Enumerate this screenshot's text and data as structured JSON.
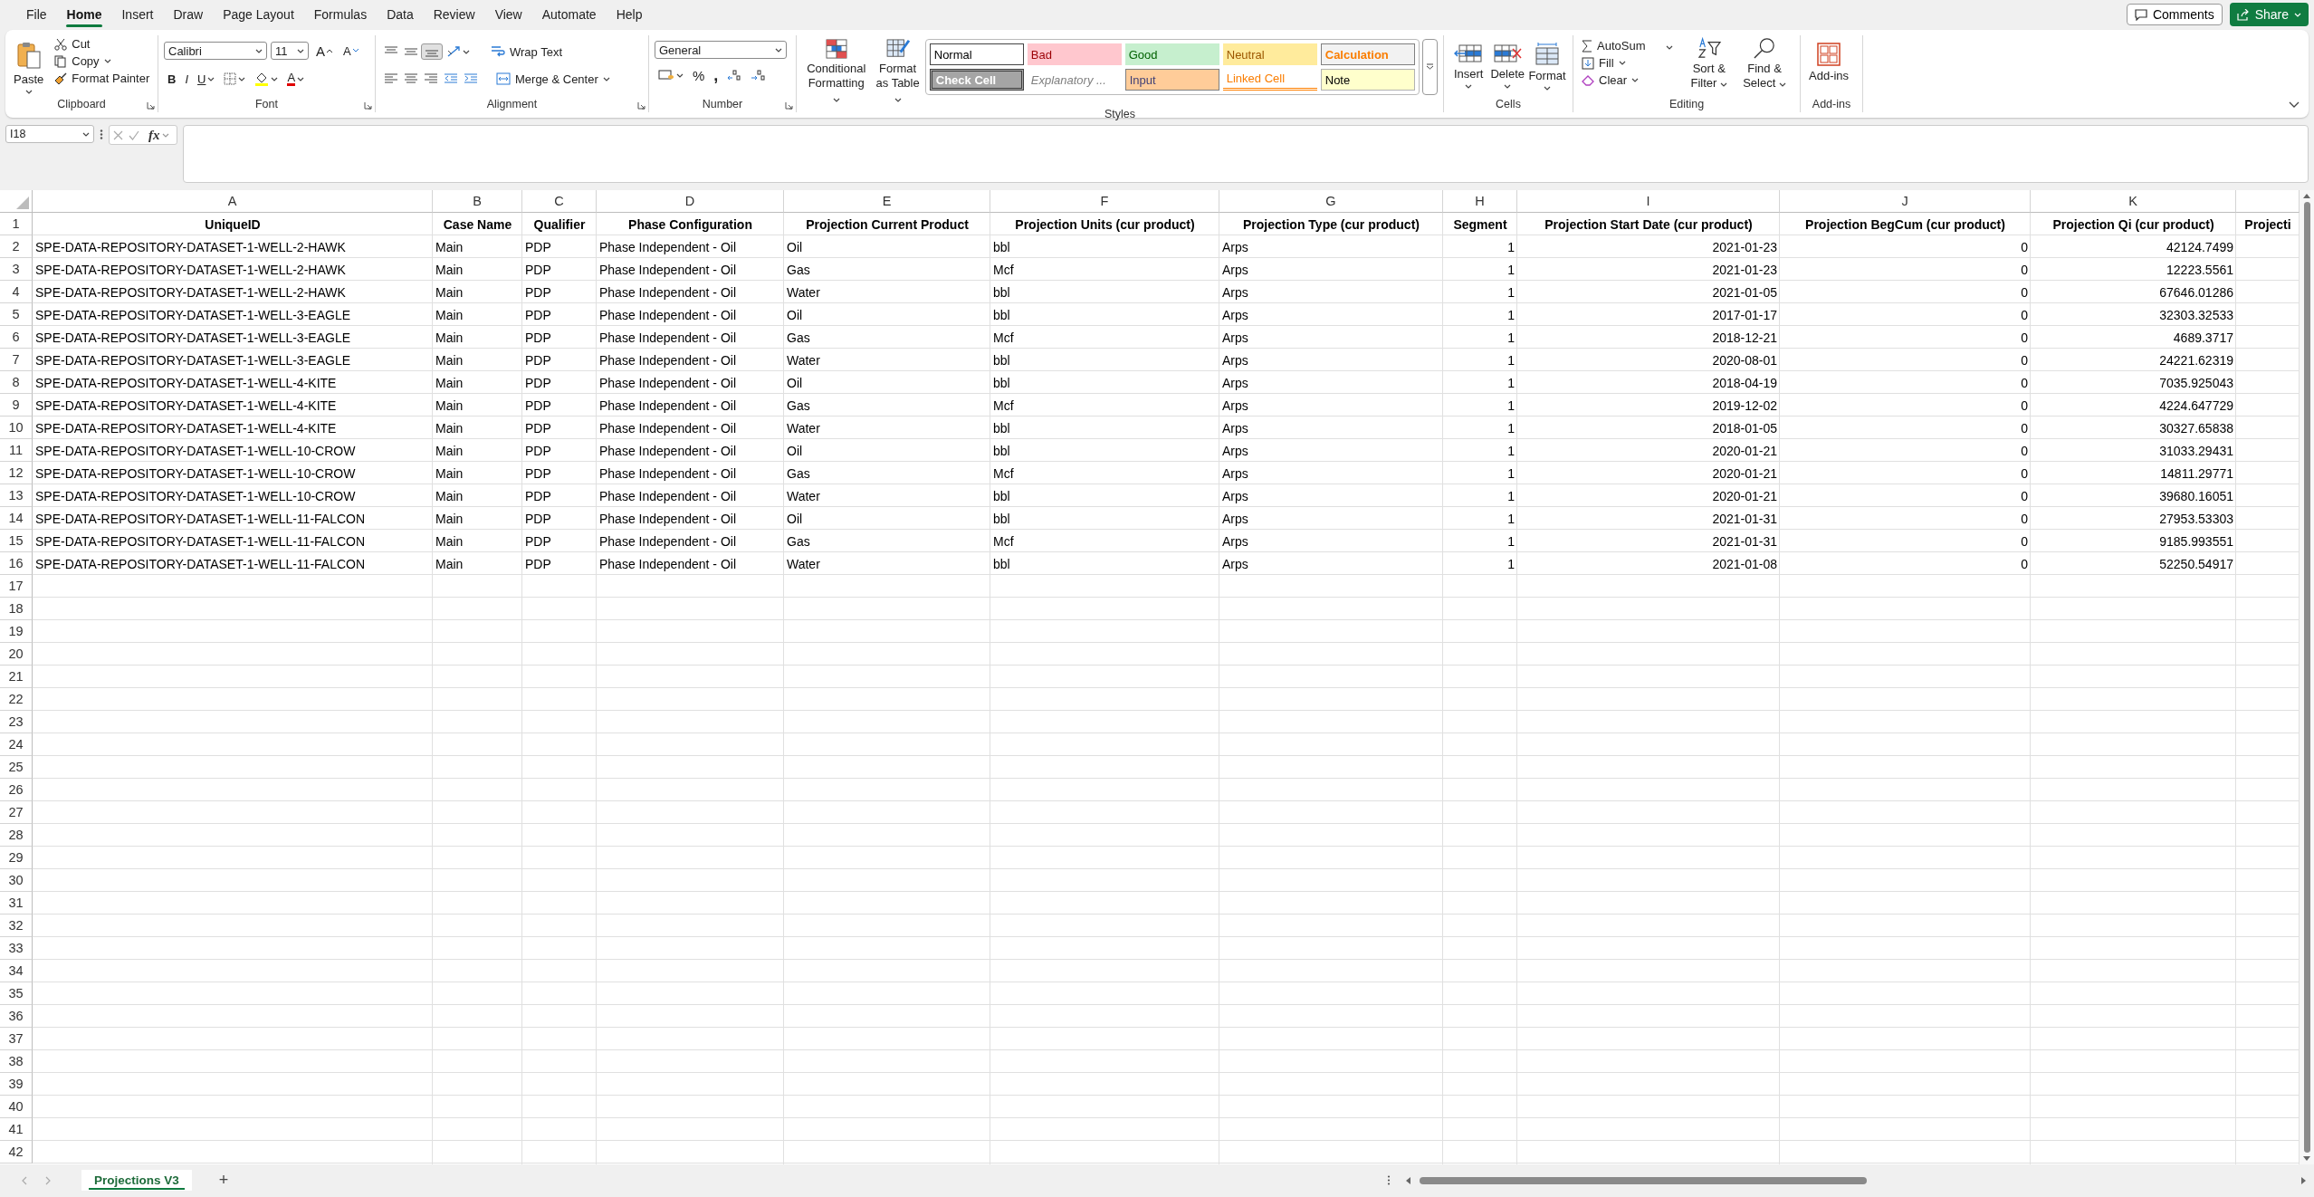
{
  "menu": [
    {
      "label": "File",
      "selected": false
    },
    {
      "label": "Home",
      "selected": true
    },
    {
      "label": "Insert",
      "selected": false
    },
    {
      "label": "Draw",
      "selected": false
    },
    {
      "label": "Page Layout",
      "selected": false
    },
    {
      "label": "Formulas",
      "selected": false
    },
    {
      "label": "Data",
      "selected": false
    },
    {
      "label": "Review",
      "selected": false
    },
    {
      "label": "View",
      "selected": false
    },
    {
      "label": "Automate",
      "selected": false
    },
    {
      "label": "Help",
      "selected": false
    }
  ],
  "comments_button": "Comments",
  "share_button": "Share",
  "ribbon": {
    "clipboard": {
      "label": "Clipboard",
      "paste": "Paste",
      "cut": "Cut",
      "copy": "Copy",
      "format_painter": "Format Painter"
    },
    "font": {
      "label": "Font",
      "family": "Calibri",
      "size": "11",
      "grow": "A",
      "shrink": "A",
      "bold": "B",
      "italic": "I",
      "underline": "U",
      "font_color": "A"
    },
    "alignment": {
      "label": "Alignment",
      "wrap_text": "Wrap Text",
      "merge_center": "Merge & Center"
    },
    "number": {
      "label": "Number",
      "format": "General",
      "percent": "%",
      "comma": ","
    },
    "styles": {
      "label": "Styles",
      "conditional_formatting": "Conditional Formatting",
      "format_as_table": "Format as Table",
      "cells": [
        {
          "label": "Normal",
          "kind": "normal"
        },
        {
          "label": "Bad",
          "kind": "bad"
        },
        {
          "label": "Good",
          "kind": "good"
        },
        {
          "label": "Neutral",
          "kind": "neutral"
        },
        {
          "label": "Calculation",
          "kind": "calculation"
        },
        {
          "label": "Check Cell",
          "kind": "check"
        },
        {
          "label": "Explanatory ...",
          "kind": "explanatory"
        },
        {
          "label": "Input",
          "kind": "input"
        },
        {
          "label": "Linked Cell",
          "kind": "linked"
        },
        {
          "label": "Note",
          "kind": "note"
        }
      ]
    },
    "cells": {
      "label": "Cells",
      "buttons": [
        {
          "label": "Insert",
          "kind": "insert"
        },
        {
          "label": "Delete",
          "kind": "delete"
        },
        {
          "label": "Format",
          "kind": "format"
        }
      ]
    },
    "editing": {
      "label": "Editing",
      "autosum": "AutoSum",
      "fill": "Fill",
      "clear": "Clear",
      "sort_filter": "Sort & Filter",
      "find_select": "Find & Select"
    },
    "addins": {
      "label": "Add-ins",
      "button": "Add-ins"
    }
  },
  "formula_bar": {
    "name_box": "I18",
    "fx": "fx"
  },
  "sheet": {
    "columns": [
      {
        "letter": "A",
        "kind": "text"
      },
      {
        "letter": "B",
        "kind": "text"
      },
      {
        "letter": "C",
        "kind": "text"
      },
      {
        "letter": "D",
        "kind": "text"
      },
      {
        "letter": "E",
        "kind": "text"
      },
      {
        "letter": "F",
        "kind": "text"
      },
      {
        "letter": "G",
        "kind": "text"
      },
      {
        "letter": "H",
        "kind": "number"
      },
      {
        "letter": "I",
        "kind": "number"
      },
      {
        "letter": "J",
        "kind": "number"
      },
      {
        "letter": "K",
        "kind": "number"
      },
      {
        "kind": "text"
      }
    ],
    "header_row": [
      "UniqueID",
      "Case Name",
      "Qualifier",
      "Phase Configuration",
      "Projection Current Product",
      "Projection Units (cur product)",
      "Projection Type (cur product)",
      "Segment",
      "Projection Start Date (cur product)",
      "Projection BegCum (cur product)",
      "Projection Qi (cur product)",
      "Projecti"
    ],
    "rows": [
      [
        "SPE-DATA-REPOSITORY-DATASET-1-WELL-2-HAWK",
        "Main",
        "PDP",
        "Phase Independent - Oil",
        "Oil",
        "bbl",
        "Arps",
        "1",
        "2021-01-23",
        "0",
        "42124.7499"
      ],
      [
        "SPE-DATA-REPOSITORY-DATASET-1-WELL-2-HAWK",
        "Main",
        "PDP",
        "Phase Independent - Oil",
        "Gas",
        "Mcf",
        "Arps",
        "1",
        "2021-01-23",
        "0",
        "12223.5561"
      ],
      [
        "SPE-DATA-REPOSITORY-DATASET-1-WELL-2-HAWK",
        "Main",
        "PDP",
        "Phase Independent - Oil",
        "Water",
        "bbl",
        "Arps",
        "1",
        "2021-01-05",
        "0",
        "67646.01286"
      ],
      [
        "SPE-DATA-REPOSITORY-DATASET-1-WELL-3-EAGLE",
        "Main",
        "PDP",
        "Phase Independent - Oil",
        "Oil",
        "bbl",
        "Arps",
        "1",
        "2017-01-17",
        "0",
        "32303.32533"
      ],
      [
        "SPE-DATA-REPOSITORY-DATASET-1-WELL-3-EAGLE",
        "Main",
        "PDP",
        "Phase Independent - Oil",
        "Gas",
        "Mcf",
        "Arps",
        "1",
        "2018-12-21",
        "0",
        "4689.3717"
      ],
      [
        "SPE-DATA-REPOSITORY-DATASET-1-WELL-3-EAGLE",
        "Main",
        "PDP",
        "Phase Independent - Oil",
        "Water",
        "bbl",
        "Arps",
        "1",
        "2020-08-01",
        "0",
        "24221.62319"
      ],
      [
        "SPE-DATA-REPOSITORY-DATASET-1-WELL-4-KITE",
        "Main",
        "PDP",
        "Phase Independent - Oil",
        "Oil",
        "bbl",
        "Arps",
        "1",
        "2018-04-19",
        "0",
        "7035.925043"
      ],
      [
        "SPE-DATA-REPOSITORY-DATASET-1-WELL-4-KITE",
        "Main",
        "PDP",
        "Phase Independent - Oil",
        "Gas",
        "Mcf",
        "Arps",
        "1",
        "2019-12-02",
        "0",
        "4224.647729"
      ],
      [
        "SPE-DATA-REPOSITORY-DATASET-1-WELL-4-KITE",
        "Main",
        "PDP",
        "Phase Independent - Oil",
        "Water",
        "bbl",
        "Arps",
        "1",
        "2018-01-05",
        "0",
        "30327.65838"
      ],
      [
        "SPE-DATA-REPOSITORY-DATASET-1-WELL-10-CROW",
        "Main",
        "PDP",
        "Phase Independent - Oil",
        "Oil",
        "bbl",
        "Arps",
        "1",
        "2020-01-21",
        "0",
        "31033.29431"
      ],
      [
        "SPE-DATA-REPOSITORY-DATASET-1-WELL-10-CROW",
        "Main",
        "PDP",
        "Phase Independent - Oil",
        "Gas",
        "Mcf",
        "Arps",
        "1",
        "2020-01-21",
        "0",
        "14811.29771"
      ],
      [
        "SPE-DATA-REPOSITORY-DATASET-1-WELL-10-CROW",
        "Main",
        "PDP",
        "Phase Independent - Oil",
        "Water",
        "bbl",
        "Arps",
        "1",
        "2020-01-21",
        "0",
        "39680.16051"
      ],
      [
        "SPE-DATA-REPOSITORY-DATASET-1-WELL-11-FALCON",
        "Main",
        "PDP",
        "Phase Independent - Oil",
        "Oil",
        "bbl",
        "Arps",
        "1",
        "2021-01-31",
        "0",
        "27953.53303"
      ],
      [
        "SPE-DATA-REPOSITORY-DATASET-1-WELL-11-FALCON",
        "Main",
        "PDP",
        "Phase Independent - Oil",
        "Gas",
        "Mcf",
        "Arps",
        "1",
        "2021-01-31",
        "0",
        "9185.993551"
      ],
      [
        "SPE-DATA-REPOSITORY-DATASET-1-WELL-11-FALCON",
        "Main",
        "PDP",
        "Phase Independent - Oil",
        "Water",
        "bbl",
        "Arps",
        "1",
        "2021-01-08",
        "0",
        "52250.54917"
      ]
    ],
    "row_labels": [
      "1",
      "2",
      "3",
      "4",
      "5",
      "6",
      "7",
      "8",
      "9",
      "10",
      "11",
      "12",
      "13",
      "14",
      "15",
      "16",
      "17",
      "18",
      "19",
      "20",
      "21",
      "22",
      "23",
      "24",
      "25",
      "26",
      "27",
      "28",
      "29",
      "30",
      "31",
      "32",
      "33",
      "34",
      "35",
      "36",
      "37",
      "38",
      "39",
      "40",
      "41",
      "42"
    ]
  },
  "sheet_tabs": [
    {
      "label": "Projections V3",
      "selected": true
    }
  ],
  "add_sheet": "+"
}
